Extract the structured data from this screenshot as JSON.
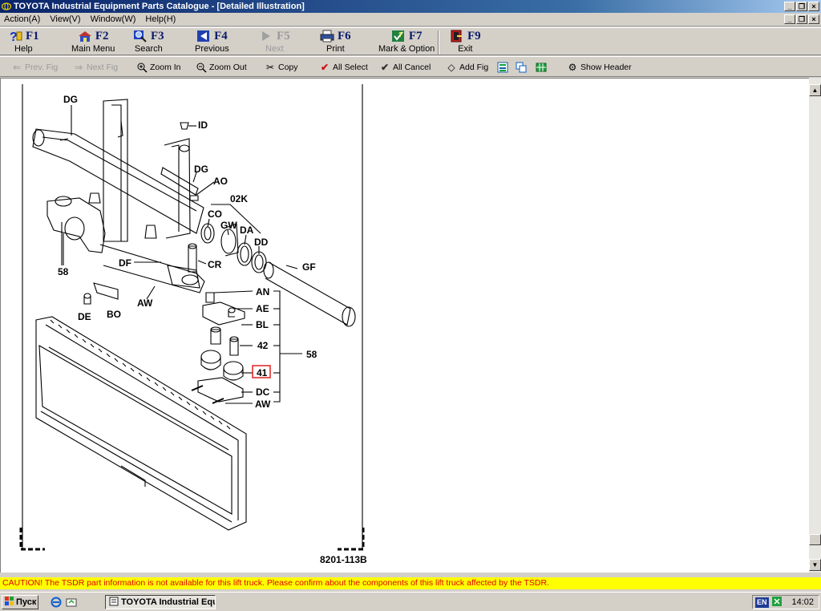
{
  "window": {
    "title": "TOYOTA Industrial Equipment Parts Catalogue - [Detailed Illustration]"
  },
  "menu": [
    "Action(A)",
    "View(V)",
    "Window(W)",
    "Help(H)"
  ],
  "fkeys": [
    {
      "key": "F1",
      "label": "Help",
      "icon": "help-icon"
    },
    {
      "key": "F2",
      "label": "Main Menu",
      "icon": "main-menu-icon"
    },
    {
      "key": "F3",
      "label": "Search",
      "icon": "search-icon"
    },
    {
      "key": "F4",
      "label": "Previous",
      "icon": "previous-icon"
    },
    {
      "key": "F5",
      "label": "Next",
      "icon": "next-icon",
      "disabled": true
    },
    {
      "key": "F6",
      "label": "Print",
      "icon": "print-icon"
    },
    {
      "key": "F7",
      "label": "Mark & Option",
      "icon": "mark-icon"
    },
    {
      "key": "F9",
      "label": "Exit",
      "icon": "exit-icon"
    }
  ],
  "toolbar": {
    "prev_fig": "Prev. Fig",
    "next_fig": "Next Fig",
    "zoom_in": "Zoom In",
    "zoom_out": "Zoom Out",
    "copy": "Copy",
    "all_select": "All Select",
    "all_cancel": "All Cancel",
    "add_fig": "Add Fig",
    "show_header": "Show Header"
  },
  "illustration": {
    "figure_number": "8201-113B",
    "callouts": {
      "dg_top": "DG",
      "id": "ID",
      "dg_mid": "DG",
      "ao": "AO",
      "k02": "02K",
      "co": "CO",
      "gw": "GW",
      "da": "DA",
      "dd": "DD",
      "gf": "GF",
      "cr": "CR",
      "df": "DF",
      "n58_left": "58",
      "aw_left": "AW",
      "de": "DE",
      "bo": "BO",
      "an": "AN",
      "ae": "AE",
      "bl": "BL",
      "n42": "42",
      "n41": "41",
      "dc": "DC",
      "aw_right": "AW",
      "n58_right": "58"
    },
    "selected_part": "41",
    "selected_color": "#e02020"
  },
  "caution": "CAUTION!   The TSDR part information is not available for this lift truck.  Please confirm about the components of this lift truck affected by the TSDR.",
  "taskbar": {
    "start": "Пуск",
    "task_button": "TOYOTA Industrial Equ...",
    "language": "EN",
    "clock": "14:02"
  }
}
